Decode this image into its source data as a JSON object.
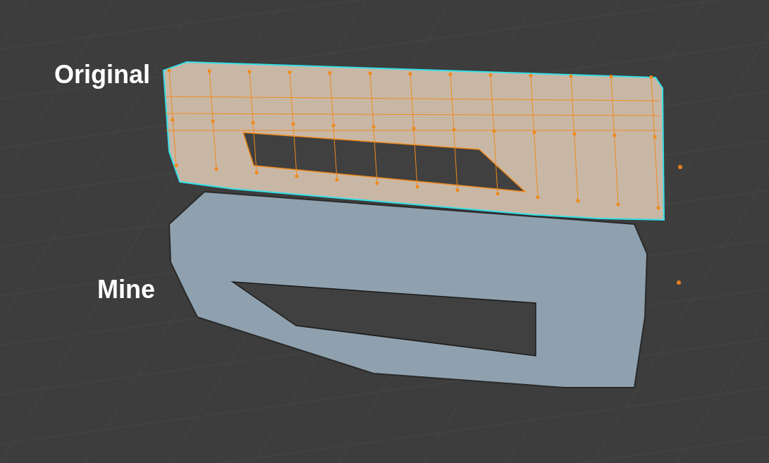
{
  "labels": [
    {
      "text": "Original"
    },
    {
      "text": "Mine"
    }
  ],
  "meshes": [
    {
      "selected": true
    },
    {
      "selected": false
    }
  ]
}
